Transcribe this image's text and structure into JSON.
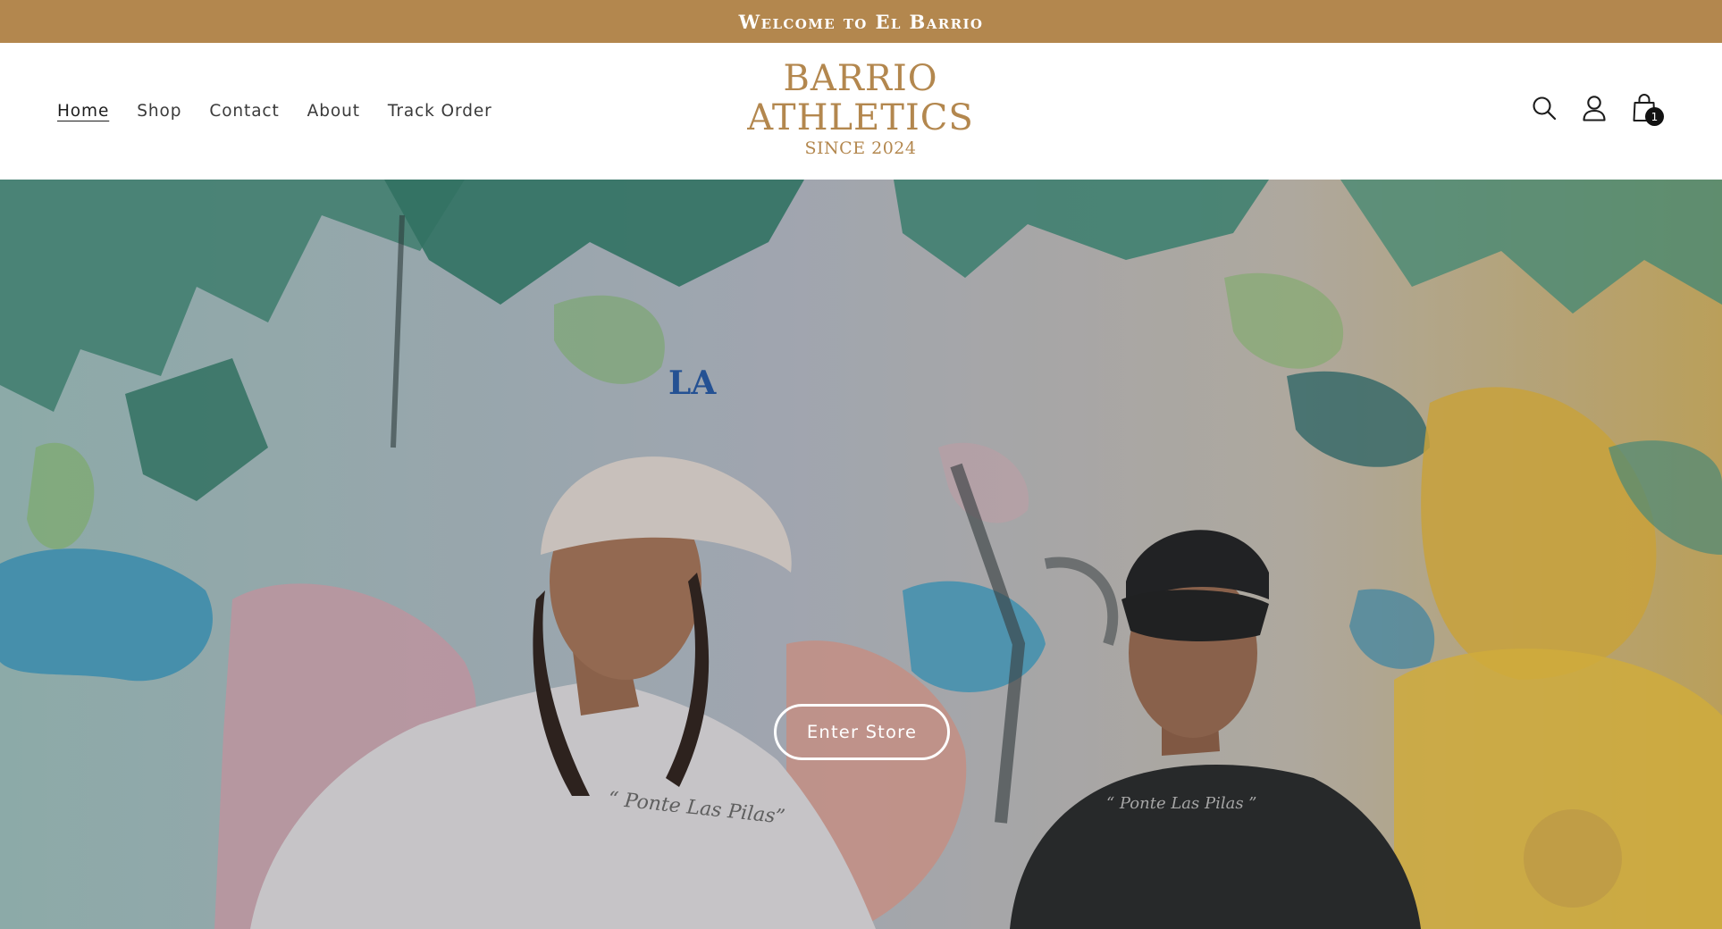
{
  "announcement": {
    "text": "Welcome to El Barrio",
    "background_color": "#b3874e"
  },
  "header": {
    "nav": [
      {
        "label": "Home",
        "active": true
      },
      {
        "label": "Shop",
        "active": false
      },
      {
        "label": "Contact",
        "active": false
      },
      {
        "label": "About",
        "active": false
      },
      {
        "label": "Track Order",
        "active": false
      }
    ],
    "logo": {
      "line1": "BARRIO",
      "line2": "ATHLETICS",
      "line3": "SINCE 2024",
      "color": "#b3874e"
    },
    "icons": {
      "search": "search-icon",
      "account": "account-icon",
      "cart": "cart-icon"
    },
    "cart_count": "1"
  },
  "hero": {
    "cta_label": "Enter Store",
    "shirt_left_text": "“ Ponte Las Pilas”",
    "shirt_right_text": "“ Ponte Las Pilas ”"
  }
}
